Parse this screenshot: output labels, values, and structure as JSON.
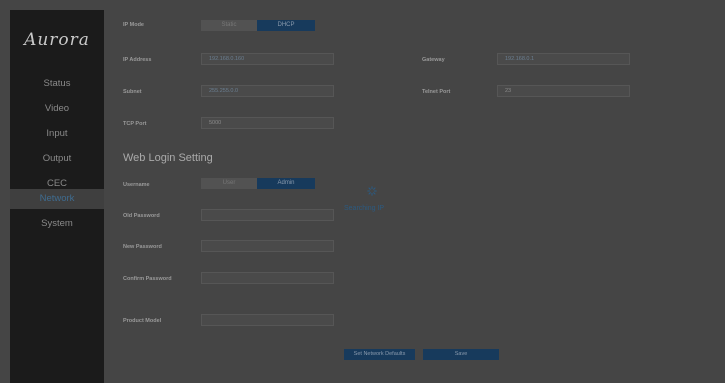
{
  "sidebar": {
    "logo": "Aurora",
    "items": [
      {
        "label": "Status",
        "active": false
      },
      {
        "label": "Video",
        "active": false
      },
      {
        "label": "Input",
        "active": false
      },
      {
        "label": "Output",
        "active": false
      },
      {
        "label": "CEC",
        "active": false
      },
      {
        "label": "Network",
        "active": true
      },
      {
        "label": "System",
        "active": false
      }
    ]
  },
  "network": {
    "ip_mode_label": "IP Mode",
    "ip_mode_options": [
      "Static",
      "DHCP"
    ],
    "ip_mode_selected": "DHCP",
    "ip_address_label": "IP Address",
    "ip_address_value": "192.168.0.160",
    "gateway_label": "Gateway",
    "gateway_value": "192.168.0.1",
    "subnet_label": "Subnet",
    "subnet_value": "255.255.0.0",
    "telnet_port_label": "Telnet Port",
    "telnet_port_value": "23",
    "tcp_port_label": "TCP Port",
    "tcp_port_value": "5000"
  },
  "web_login": {
    "title": "Web Login Setting",
    "username_label": "Username",
    "username_options": [
      "User",
      "Admin"
    ],
    "username_selected": "Admin",
    "old_password_label": "Old Password",
    "new_password_label": "New Password",
    "confirm_password_label": "Confirm Password",
    "product_model_label": "Product Model"
  },
  "overlay": {
    "status_text": "Searching IP"
  },
  "buttons": {
    "set_network_defaults": "Set Network Defaults",
    "save": "Save"
  },
  "colors": {
    "accent": "#173a5c",
    "sidebar_bg": "#1b1b1b",
    "content_bg": "#474747"
  }
}
